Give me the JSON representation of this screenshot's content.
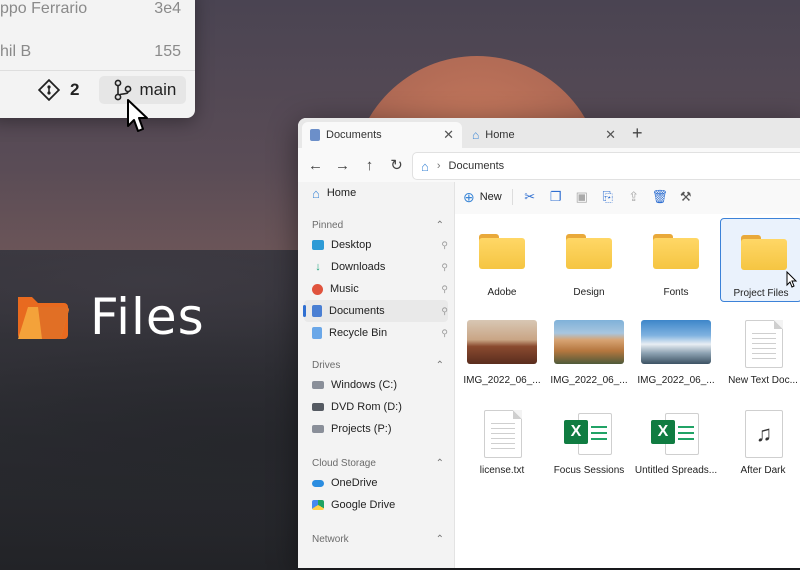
{
  "git_panel": {
    "rows": [
      {
        "name": "ppo Ferrario",
        "hash": "3e4"
      },
      {
        "name": "hil B",
        "hash": "155"
      }
    ],
    "changes_count": "2",
    "branch": "main"
  },
  "brand": {
    "title": "Files"
  },
  "window": {
    "tabs": [
      {
        "label": "Documents",
        "icon": "documents-icon",
        "active": true
      },
      {
        "label": "Home",
        "icon": "home-icon",
        "active": false
      }
    ],
    "address": {
      "crumb": "Documents"
    },
    "toolbar": {
      "new_label": "New"
    },
    "sidebar": {
      "home": "Home",
      "pinned_header": "Pinned",
      "pinned": [
        {
          "label": "Desktop",
          "icon": "desktop-icon",
          "color": "#2e9bd6"
        },
        {
          "label": "Downloads",
          "icon": "downloads-icon",
          "color": "#1aa37a"
        },
        {
          "label": "Music",
          "icon": "music-icon",
          "color": "#e0533d"
        },
        {
          "label": "Documents",
          "icon": "documents-icon",
          "color": "#4a7fd3",
          "selected": true
        },
        {
          "label": "Recycle Bin",
          "icon": "recycle-bin-icon",
          "color": "#6aa7e8"
        }
      ],
      "drives_header": "Drives",
      "drives": [
        {
          "label": "Windows (C:)",
          "icon": "windows-drive-icon"
        },
        {
          "label": "DVD Rom (D:)",
          "icon": "dvd-drive-icon"
        },
        {
          "label": "Projects (P:)",
          "icon": "drive-icon"
        }
      ],
      "cloud_header": "Cloud Storage",
      "cloud": [
        {
          "label": "OneDrive",
          "icon": "onedrive-icon"
        },
        {
          "label": "Google Drive",
          "icon": "google-drive-icon"
        }
      ],
      "network_header": "Network"
    },
    "items": [
      {
        "label": "Adobe",
        "kind": "folder"
      },
      {
        "label": "Design",
        "kind": "folder"
      },
      {
        "label": "Fonts",
        "kind": "folder"
      },
      {
        "label": "Project Files",
        "kind": "folder",
        "selected": true
      },
      {
        "label": "IMG_2022_06_...",
        "kind": "image",
        "palette": "desert"
      },
      {
        "label": "IMG_2022_06_...",
        "kind": "image",
        "palette": "mountain"
      },
      {
        "label": "IMG_2022_06_...",
        "kind": "image",
        "palette": "snow"
      },
      {
        "label": "New Text Doc...",
        "kind": "text"
      },
      {
        "label": "license.txt",
        "kind": "text"
      },
      {
        "label": "Focus Sessions",
        "kind": "excel"
      },
      {
        "label": "Untitled Spreads...",
        "kind": "excel"
      },
      {
        "label": "After Dark",
        "kind": "music"
      }
    ]
  }
}
